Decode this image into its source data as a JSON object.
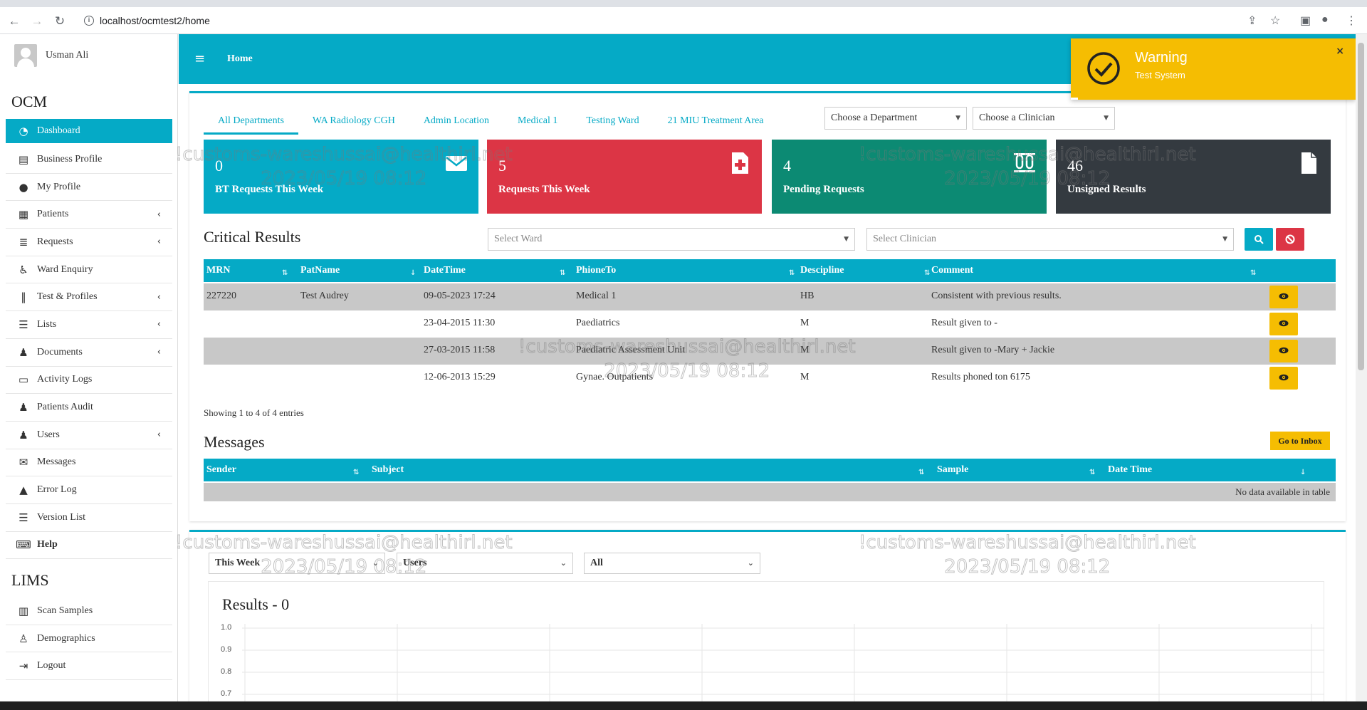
{
  "browser": {
    "url": "localhost/ocmtest2/home"
  },
  "user": {
    "name": "Usman Ali"
  },
  "sidebar": {
    "ocm_title": "OCM",
    "ocm_items": [
      {
        "label": "Dashboard",
        "icon": "dashboard-icon",
        "active": true
      },
      {
        "label": "Business Profile",
        "icon": "building-icon"
      },
      {
        "label": "My Profile",
        "icon": "user-icon"
      },
      {
        "label": "Patients",
        "icon": "patient-icon",
        "arrow": "‹"
      },
      {
        "label": "Requests",
        "icon": "database-icon",
        "arrow": "‹"
      },
      {
        "label": "Ward Enquiry",
        "icon": "wheelchair-icon"
      },
      {
        "label": "Test & Profiles",
        "icon": "test-tubes-icon",
        "arrow": "‹"
      },
      {
        "label": "Lists",
        "icon": "list-icon",
        "arrow": "‹"
      },
      {
        "label": "Documents",
        "icon": "users-group-icon",
        "arrow": "‹"
      },
      {
        "label": "Activity Logs",
        "icon": "archive-icon"
      },
      {
        "label": "Patients Audit",
        "icon": "users-group-icon"
      },
      {
        "label": "Users",
        "icon": "users-group-icon",
        "arrow": "‹"
      },
      {
        "label": "Messages",
        "icon": "envelope-icon"
      },
      {
        "label": "Error Log",
        "icon": "warning-icon"
      },
      {
        "label": "Version List",
        "icon": "list-icon"
      },
      {
        "label": "Help",
        "icon": "keyboard-icon"
      }
    ],
    "lims_title": "LIMS",
    "lims_items": [
      {
        "label": "Scan Samples",
        "icon": "barcode-icon"
      },
      {
        "label": "Demographics",
        "icon": "user-tie-icon"
      },
      {
        "label": "Logout",
        "icon": "sign-out-icon"
      }
    ]
  },
  "header": {
    "title": "Home"
  },
  "toast": {
    "title": "Warning",
    "message": "Test System",
    "close": "×"
  },
  "dept_tabs": [
    "All Departments",
    "WA Radiology CGH",
    "Admin Location",
    "Medical 1",
    "Testing Ward",
    "21 MIU Treatment Area"
  ],
  "filters": {
    "department": "Choose a Department",
    "clinician": "Choose a Clinician"
  },
  "stats": [
    {
      "value": "0",
      "label": "BT Requests This Week",
      "color": "#05aac6",
      "icon": "envelope-icon"
    },
    {
      "value": "5",
      "label": "Requests This Week",
      "color": "#dc3545",
      "icon": "medical-file-icon"
    },
    {
      "value": "4",
      "label": "Pending Requests",
      "color": "#0c8a73",
      "icon": "test-tubes-icon"
    },
    {
      "value": "46",
      "label": "Unsigned Results",
      "color": "#343a40",
      "icon": "file-icon"
    }
  ],
  "critical": {
    "title": "Critical Results",
    "ward_placeholder": "Select Ward",
    "clinician_placeholder": "Select Clinician",
    "columns": [
      "MRN",
      "PatName",
      "DateTime",
      "PhioneTo",
      "Descipline",
      "Comment"
    ],
    "rows": [
      [
        "227220",
        "Test Audrey",
        "09-05-2023 17:24",
        "Medical 1",
        "HB",
        "Consistent with previous results."
      ],
      [
        "",
        "",
        "23-04-2015 11:30",
        "Paediatrics",
        "M",
        "Result given to -"
      ],
      [
        "",
        "",
        "27-03-2015 11:58",
        "Paediatric Assessment Unit",
        "M",
        "Result given to -Mary + Jackie"
      ],
      [
        "",
        "",
        "12-06-2013 15:29",
        "Gynae. Outpatients",
        "M",
        "Results phoned ton 6175"
      ]
    ],
    "info": "Showing 1 to 4 of 4 entries"
  },
  "messages": {
    "title": "Messages",
    "inbox_button": "Go to Inbox",
    "columns": [
      "Sender",
      "Subject",
      "Sample",
      "Date Time"
    ],
    "empty": "No data available in table"
  },
  "bottom": {
    "period": "This Week",
    "users": "Users",
    "all": "All",
    "results_title": "Results - 0",
    "y_ticks": [
      "1.0",
      "0.9",
      "0.8",
      "0.7"
    ]
  },
  "watermark": {
    "line1": "!customs-wareshussai@healthirl.net",
    "line2": "2023/05/19 08:12"
  }
}
